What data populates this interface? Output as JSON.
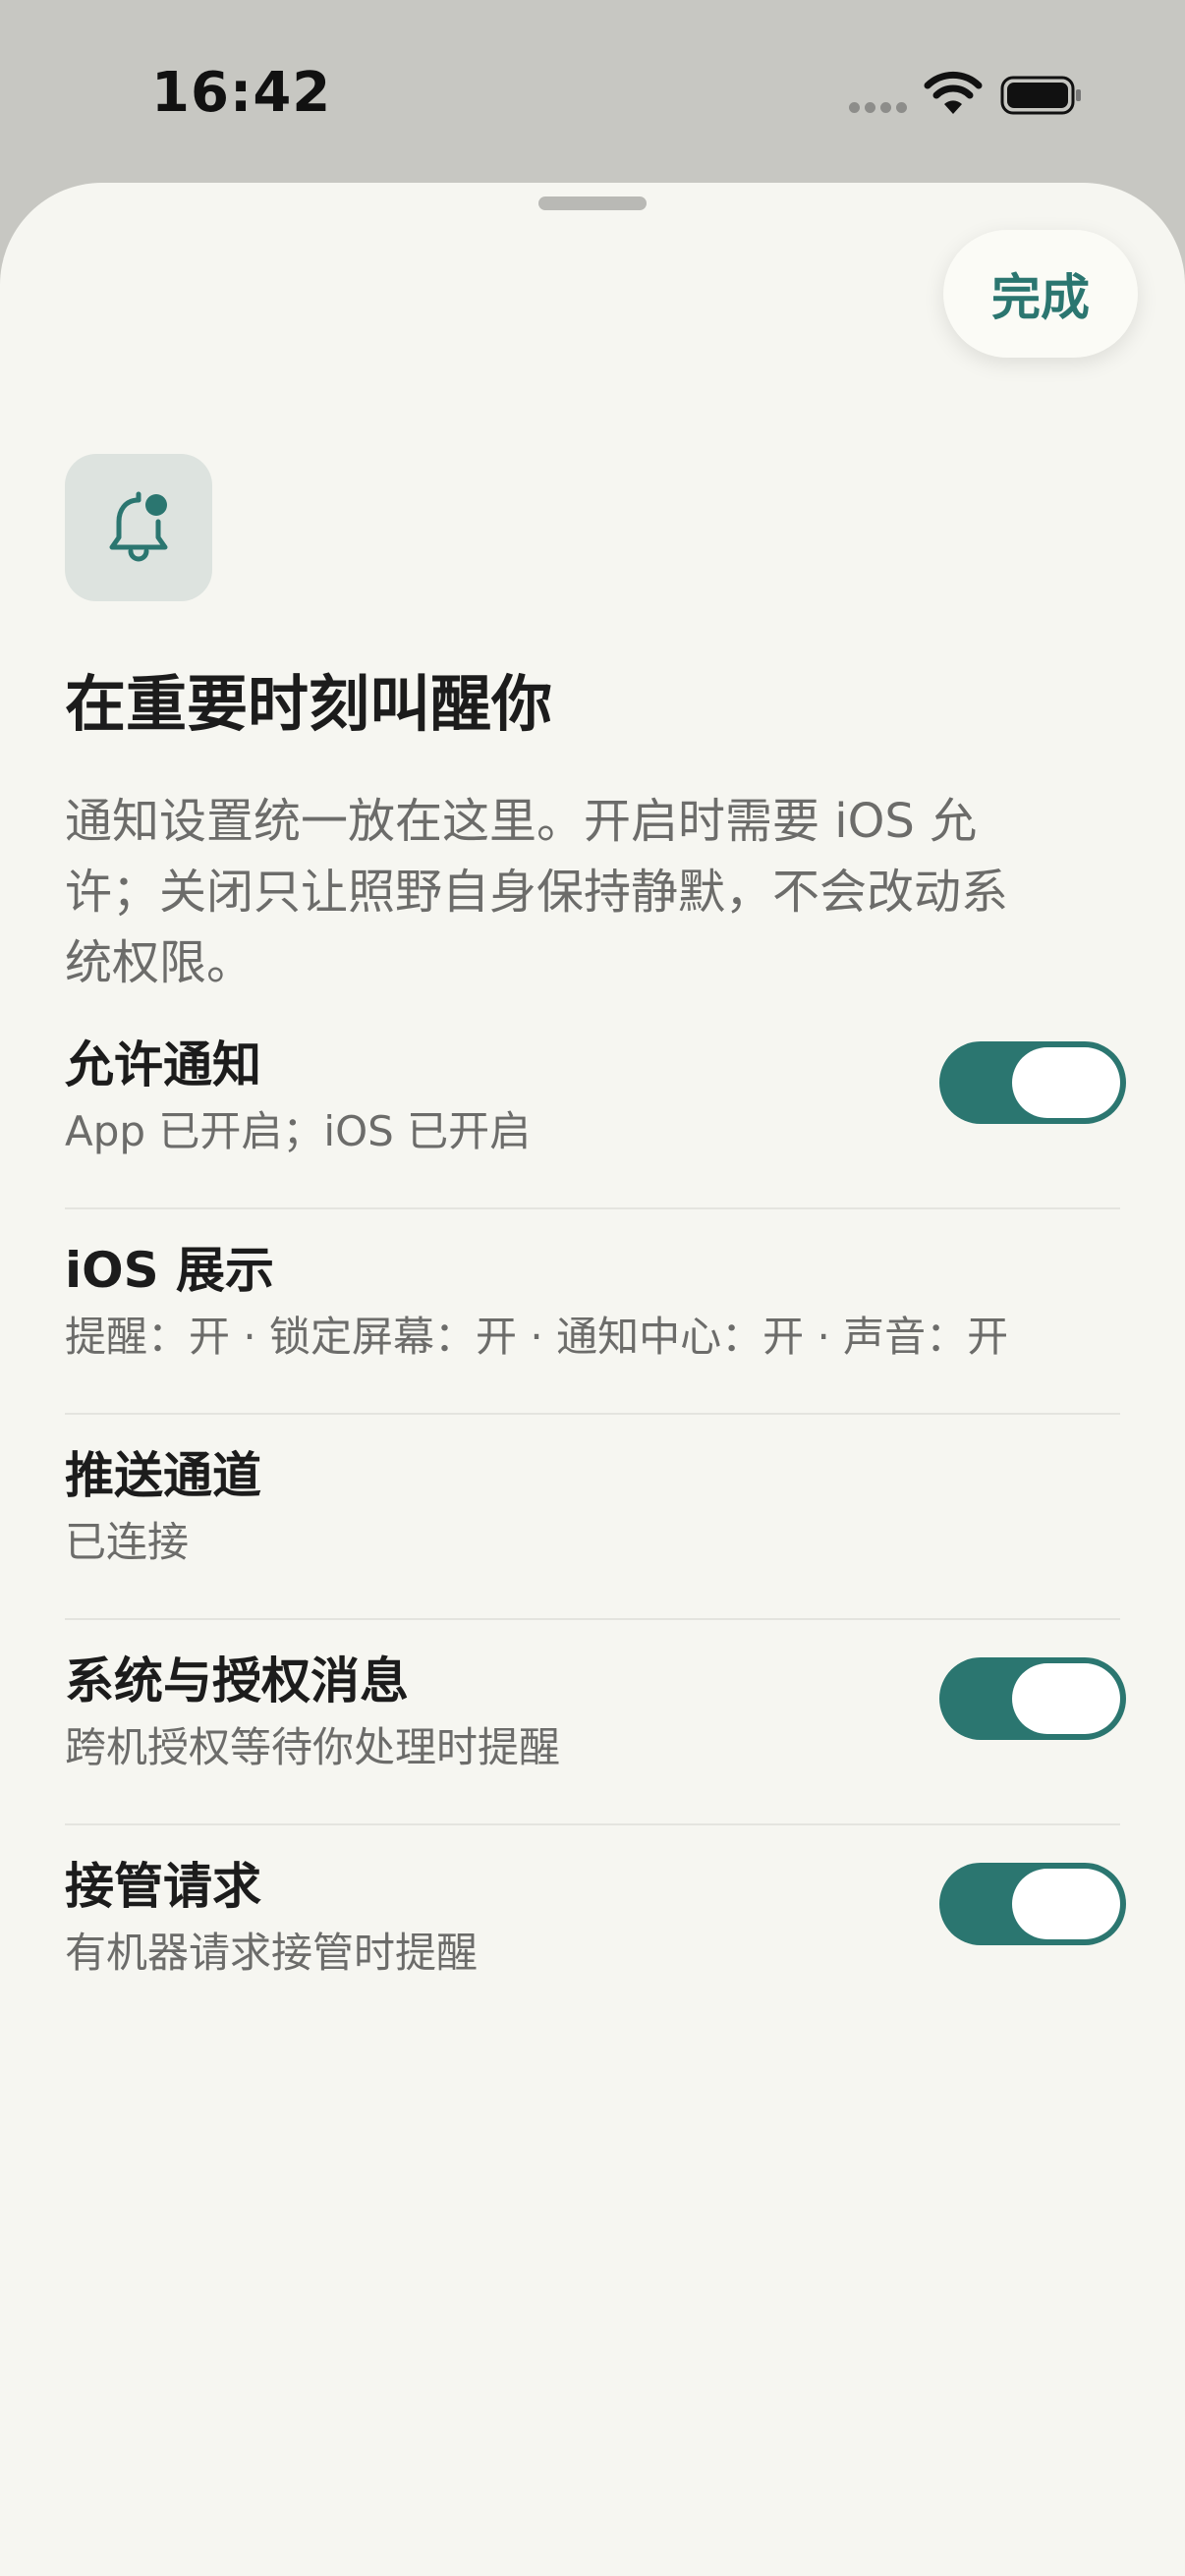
{
  "status_bar": {
    "time": "16:42"
  },
  "sheet": {
    "done_label": "完成",
    "icon": "bell-badge-icon",
    "title": "在重要时刻叫醒你",
    "description": "通知设置统一放在这里。开启时需要 iOS 允许；关闭只让照野自身保持静默，不会改动系统权限。"
  },
  "settings": [
    {
      "title": "允许通知",
      "subtitle": "App 已开启；iOS 已开启",
      "toggle": true
    },
    {
      "title": "iOS 展示",
      "subtitle": "提醒：开 · 锁定屏幕：开 · 通知中心：开 · 声音：开",
      "toggle": null
    },
    {
      "title": "推送通道",
      "subtitle": "已连接",
      "toggle": null
    },
    {
      "title": "系统与授权消息",
      "subtitle": "跨机授权等待你处理时提醒",
      "toggle": true
    },
    {
      "title": "接管请求",
      "subtitle": "有机器请求接管时提醒",
      "toggle": true
    }
  ],
  "colors": {
    "accent": "#2b7670",
    "sheet_background": "#f6f6f1",
    "status_background": "#c7c7c2"
  }
}
